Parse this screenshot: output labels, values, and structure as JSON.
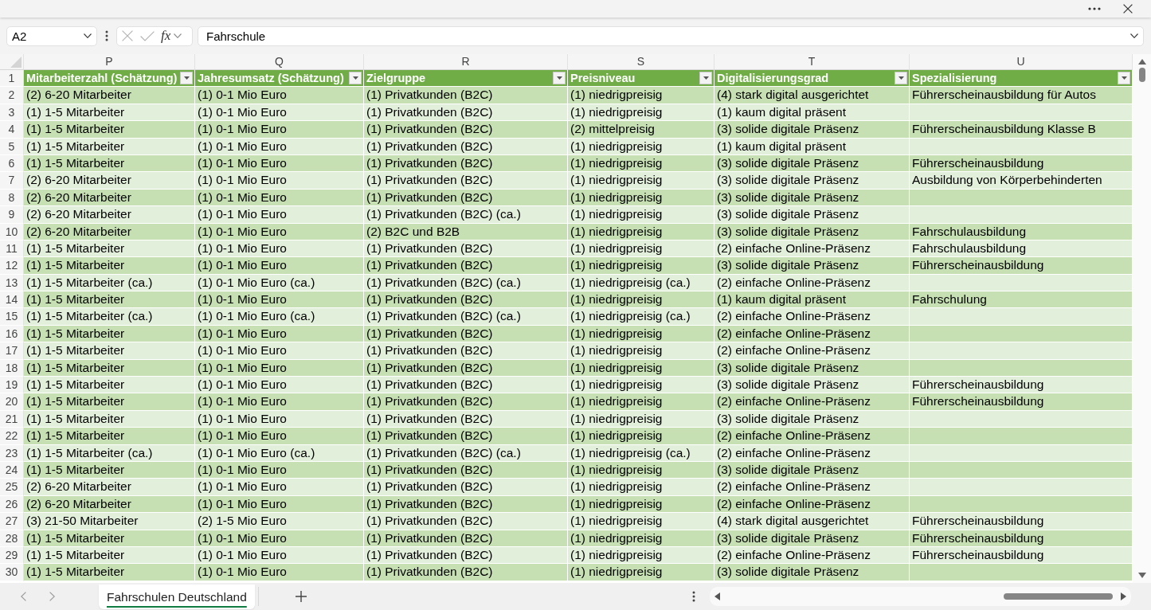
{
  "formula_bar": {
    "name_box": "A2",
    "cancel_button": {
      "disabled": true
    },
    "enter_button": {
      "disabled": true
    },
    "function_button": "fx",
    "formula": "Fahrschule"
  },
  "sheet": {
    "columns": [
      "P",
      "Q",
      "R",
      "S",
      "T",
      "U"
    ],
    "header_row": {
      "number": "1",
      "cells": [
        "Mitarbeiterzahl (Schätzung)",
        "Jahresumsatz (Schätzung)",
        "Zielgruppe",
        "Preisniveau",
        "Digitalisierungsgrad",
        "Spezialisierung"
      ]
    },
    "rows": [
      {
        "number": "2",
        "cells": [
          "(2) 6-20 Mitarbeiter",
          "(1) 0-1 Mio Euro",
          "(1) Privatkunden (B2C)",
          "(1) niedrigpreisig",
          "(4) stark digital ausgerichtet",
          "Führerscheinausbildung für Autos"
        ]
      },
      {
        "number": "3",
        "cells": [
          "(1) 1-5 Mitarbeiter",
          "(1) 0-1 Mio Euro",
          "(1) Privatkunden (B2C)",
          "(1) niedrigpreisig",
          "(1) kaum digital präsent"
        ]
      },
      {
        "number": "4",
        "cells": [
          "(1) 1-5 Mitarbeiter",
          "(1) 0-1 Mio Euro",
          "(1) Privatkunden (B2C)",
          "(2) mittelpreisig",
          "(3) solide digitale Präsenz",
          "Führerscheinausbildung Klasse B"
        ]
      },
      {
        "number": "5",
        "cells": [
          "(1) 1-5 Mitarbeiter",
          "(1) 0-1 Mio Euro",
          "(1) Privatkunden (B2C)",
          "(1) niedrigpreisig",
          "(1) kaum digital präsent"
        ]
      },
      {
        "number": "6",
        "cells": [
          "(1) 1-5 Mitarbeiter",
          "(1) 0-1 Mio Euro",
          "(1) Privatkunden (B2C)",
          "(1) niedrigpreisig",
          "(3) solide digitale Präsenz",
          "Führerscheinausbildung"
        ]
      },
      {
        "number": "7",
        "cells": [
          "(2) 6-20 Mitarbeiter",
          "(1) 0-1 Mio Euro",
          "(1) Privatkunden (B2C)",
          "(1) niedrigpreisig",
          "(3) solide digitale Präsenz",
          "Ausbildung von Körperbehinderten"
        ]
      },
      {
        "number": "8",
        "cells": [
          "(2) 6-20 Mitarbeiter",
          "(1) 0-1 Mio Euro",
          "(1) Privatkunden (B2C)",
          "(1) niedrigpreisig",
          "(3) solide digitale Präsenz"
        ]
      },
      {
        "number": "9",
        "cells": [
          "(2) 6-20 Mitarbeiter",
          "(1) 0-1 Mio Euro",
          "(1) Privatkunden (B2C) (ca.)",
          "(1) niedrigpreisig",
          "(3) solide digitale Präsenz"
        ]
      },
      {
        "number": "10",
        "cells": [
          "(2) 6-20 Mitarbeiter",
          "(1) 0-1 Mio Euro",
          "(2) B2C und B2B",
          "(1) niedrigpreisig",
          "(3) solide digitale Präsenz",
          "Fahrschulausbildung"
        ]
      },
      {
        "number": "11",
        "cells": [
          "(1) 1-5 Mitarbeiter",
          "(1) 0-1 Mio Euro",
          "(1) Privatkunden (B2C)",
          "(1) niedrigpreisig",
          "(2) einfache Online-Präsenz",
          "Fahrschulausbildung"
        ]
      },
      {
        "number": "12",
        "cells": [
          "(1) 1-5 Mitarbeiter",
          "(1) 0-1 Mio Euro",
          "(1) Privatkunden (B2C)",
          "(1) niedrigpreisig",
          "(3) solide digitale Präsenz",
          "Führerscheinausbildung"
        ]
      },
      {
        "number": "13",
        "cells": [
          "(1) 1-5 Mitarbeiter (ca.)",
          "(1) 0-1 Mio Euro (ca.)",
          "(1) Privatkunden (B2C) (ca.)",
          "(1) niedrigpreisig (ca.)",
          "(2) einfache Online-Präsenz"
        ]
      },
      {
        "number": "14",
        "cells": [
          "(1) 1-5 Mitarbeiter",
          "(1) 0-1 Mio Euro",
          "(1) Privatkunden (B2C)",
          "(1) niedrigpreisig",
          "(1) kaum digital präsent",
          "Fahrschulung"
        ]
      },
      {
        "number": "15",
        "cells": [
          "(1) 1-5 Mitarbeiter (ca.)",
          "(1) 0-1 Mio Euro (ca.)",
          "(1) Privatkunden (B2C) (ca.)",
          "(1) niedrigpreisig (ca.)",
          "(2) einfache Online-Präsenz"
        ]
      },
      {
        "number": "16",
        "cells": [
          "(1) 1-5 Mitarbeiter",
          "(1) 0-1 Mio Euro",
          "(1) Privatkunden (B2C)",
          "(1) niedrigpreisig",
          "(2) einfache Online-Präsenz"
        ]
      },
      {
        "number": "17",
        "cells": [
          "(1) 1-5 Mitarbeiter",
          "(1) 0-1 Mio Euro",
          "(1) Privatkunden (B2C)",
          "(1) niedrigpreisig",
          "(2) einfache Online-Präsenz"
        ]
      },
      {
        "number": "18",
        "cells": [
          "(1) 1-5 Mitarbeiter",
          "(1) 0-1 Mio Euro",
          "(1) Privatkunden (B2C)",
          "(1) niedrigpreisig",
          "(3) solide digitale Präsenz"
        ]
      },
      {
        "number": "19",
        "cells": [
          "(1) 1-5 Mitarbeiter",
          "(1) 0-1 Mio Euro",
          "(1) Privatkunden (B2C)",
          "(1) niedrigpreisig",
          "(3) solide digitale Präsenz",
          "Führerscheinausbildung"
        ]
      },
      {
        "number": "20",
        "cells": [
          "(1) 1-5 Mitarbeiter",
          "(1) 0-1 Mio Euro",
          "(1) Privatkunden (B2C)",
          "(1) niedrigpreisig",
          "(2) einfache Online-Präsenz",
          "Führerscheinausbildung"
        ]
      },
      {
        "number": "21",
        "cells": [
          "(1) 1-5 Mitarbeiter",
          "(1) 0-1 Mio Euro",
          "(1) Privatkunden (B2C)",
          "(1) niedrigpreisig",
          "(3) solide digitale Präsenz"
        ]
      },
      {
        "number": "22",
        "cells": [
          "(1) 1-5 Mitarbeiter",
          "(1) 0-1 Mio Euro",
          "(1) Privatkunden (B2C)",
          "(1) niedrigpreisig",
          "(2) einfache Online-Präsenz"
        ]
      },
      {
        "number": "23",
        "cells": [
          "(1) 1-5 Mitarbeiter (ca.)",
          "(1) 0-1 Mio Euro (ca.)",
          "(1) Privatkunden (B2C) (ca.)",
          "(1) niedrigpreisig (ca.)",
          "(2) einfache Online-Präsenz"
        ]
      },
      {
        "number": "24",
        "cells": [
          "(1) 1-5 Mitarbeiter",
          "(1) 0-1 Mio Euro",
          "(1) Privatkunden (B2C)",
          "(1) niedrigpreisig",
          "(3) solide digitale Präsenz"
        ]
      },
      {
        "number": "25",
        "cells": [
          "(2) 6-20 Mitarbeiter",
          "(1) 0-1 Mio Euro",
          "(1) Privatkunden (B2C)",
          "(1) niedrigpreisig",
          "(2) einfache Online-Präsenz"
        ]
      },
      {
        "number": "26",
        "cells": [
          "(2) 6-20 Mitarbeiter",
          "(1) 0-1 Mio Euro",
          "(1) Privatkunden (B2C)",
          "(1) niedrigpreisig",
          "(2) einfache Online-Präsenz"
        ]
      },
      {
        "number": "27",
        "cells": [
          "(3) 21-50 Mitarbeiter",
          "(2) 1-5 Mio Euro",
          "(1) Privatkunden (B2C)",
          "(1) niedrigpreisig",
          "(4) stark digital ausgerichtet",
          "Führerscheinausbildung"
        ]
      },
      {
        "number": "28",
        "cells": [
          "(1) 1-5 Mitarbeiter",
          "(1) 0-1 Mio Euro",
          "(1) Privatkunden (B2C)",
          "(1) niedrigpreisig",
          "(3) solide digitale Präsenz",
          "Führerscheinausbildung"
        ]
      },
      {
        "number": "29",
        "cells": [
          "(1) 1-5 Mitarbeiter",
          "(1) 0-1 Mio Euro",
          "(1) Privatkunden (B2C)",
          "(1) niedrigpreisig",
          "(2) einfache Online-Präsenz",
          "Führerscheinausbildung"
        ]
      },
      {
        "number": "30",
        "cells": [
          "(1) 1-5 Mitarbeiter",
          "(1) 0-1 Mio Euro",
          "(1) Privatkunden (B2C)",
          "(1) niedrigpreisig",
          "(3) solide digitale Präsenz"
        ]
      }
    ]
  },
  "sheet_tabs": [
    {
      "label": "Fahrschulen Deutschland",
      "selected": true
    }
  ]
}
